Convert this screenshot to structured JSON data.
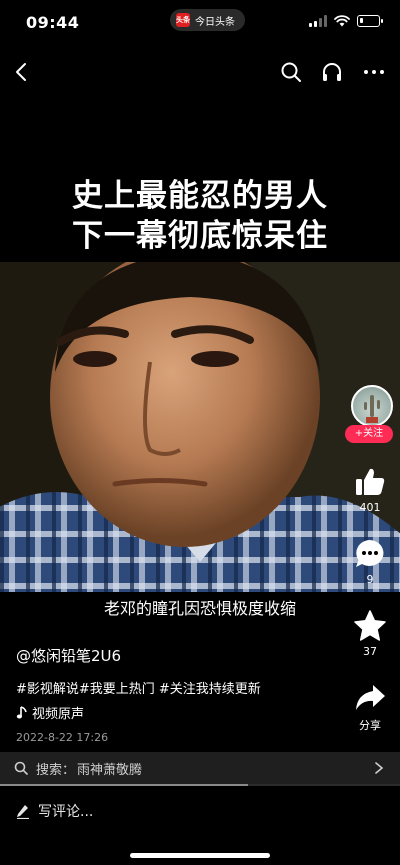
{
  "status": {
    "time": "09:44",
    "app_name": "今日头条",
    "app_logo_text": "头条"
  },
  "nav": {
    "back_icon": "chevron-left-icon",
    "search_icon": "search-icon",
    "listen_icon": "headphone-icon",
    "more_icon": "more-dots-icon"
  },
  "video": {
    "headline_line1": "史上最能忍的男人",
    "headline_line2": "下一幕彻底惊呆住",
    "subtitle": "老邓的瞳孔因恐惧极度收缩"
  },
  "rail": {
    "follow_label": "+关注",
    "likes": "401",
    "comments": "9",
    "favorites": "37",
    "share_label": "分享"
  },
  "meta": {
    "author": "@悠闲铅笔2U6",
    "tags": "#影视解说#我要上热门 #关注我持续更新",
    "music": "视频原声",
    "date": "2022-8-22 17:26"
  },
  "search": {
    "label": "搜索：",
    "term": "雨神萧敬腾"
  },
  "progress": {
    "fraction": 0.62
  },
  "comment": {
    "placeholder": "写评论..."
  },
  "colors": {
    "accent": "#fe2c55",
    "background": "#000000"
  }
}
